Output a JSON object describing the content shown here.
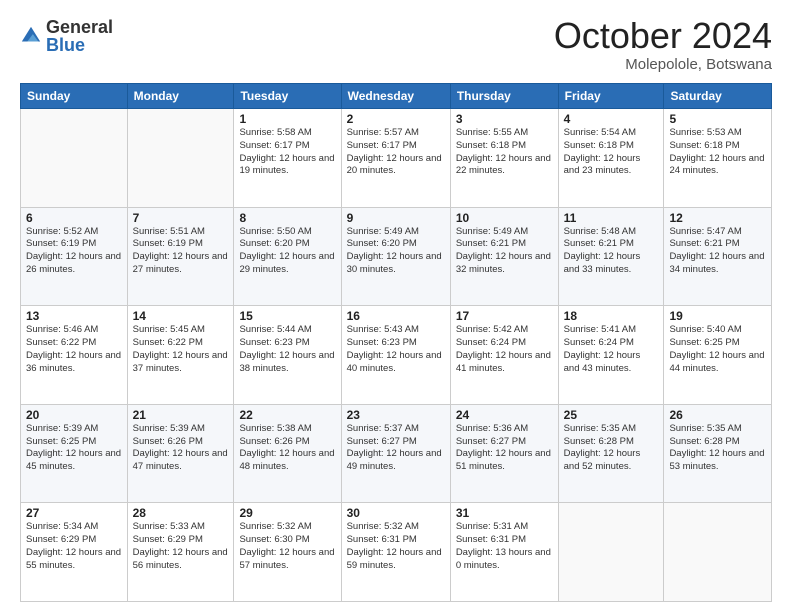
{
  "logo": {
    "general": "General",
    "blue": "Blue"
  },
  "title": "October 2024",
  "location": "Molepolole, Botswana",
  "days_of_week": [
    "Sunday",
    "Monday",
    "Tuesday",
    "Wednesday",
    "Thursday",
    "Friday",
    "Saturday"
  ],
  "weeks": [
    [
      {
        "day": "",
        "info": ""
      },
      {
        "day": "",
        "info": ""
      },
      {
        "day": "1",
        "info": "Sunrise: 5:58 AM\nSunset: 6:17 PM\nDaylight: 12 hours and 19 minutes."
      },
      {
        "day": "2",
        "info": "Sunrise: 5:57 AM\nSunset: 6:17 PM\nDaylight: 12 hours and 20 minutes."
      },
      {
        "day": "3",
        "info": "Sunrise: 5:55 AM\nSunset: 6:18 PM\nDaylight: 12 hours and 22 minutes."
      },
      {
        "day": "4",
        "info": "Sunrise: 5:54 AM\nSunset: 6:18 PM\nDaylight: 12 hours and 23 minutes."
      },
      {
        "day": "5",
        "info": "Sunrise: 5:53 AM\nSunset: 6:18 PM\nDaylight: 12 hours and 24 minutes."
      }
    ],
    [
      {
        "day": "6",
        "info": "Sunrise: 5:52 AM\nSunset: 6:19 PM\nDaylight: 12 hours and 26 minutes."
      },
      {
        "day": "7",
        "info": "Sunrise: 5:51 AM\nSunset: 6:19 PM\nDaylight: 12 hours and 27 minutes."
      },
      {
        "day": "8",
        "info": "Sunrise: 5:50 AM\nSunset: 6:20 PM\nDaylight: 12 hours and 29 minutes."
      },
      {
        "day": "9",
        "info": "Sunrise: 5:49 AM\nSunset: 6:20 PM\nDaylight: 12 hours and 30 minutes."
      },
      {
        "day": "10",
        "info": "Sunrise: 5:49 AM\nSunset: 6:21 PM\nDaylight: 12 hours and 32 minutes."
      },
      {
        "day": "11",
        "info": "Sunrise: 5:48 AM\nSunset: 6:21 PM\nDaylight: 12 hours and 33 minutes."
      },
      {
        "day": "12",
        "info": "Sunrise: 5:47 AM\nSunset: 6:21 PM\nDaylight: 12 hours and 34 minutes."
      }
    ],
    [
      {
        "day": "13",
        "info": "Sunrise: 5:46 AM\nSunset: 6:22 PM\nDaylight: 12 hours and 36 minutes."
      },
      {
        "day": "14",
        "info": "Sunrise: 5:45 AM\nSunset: 6:22 PM\nDaylight: 12 hours and 37 minutes."
      },
      {
        "day": "15",
        "info": "Sunrise: 5:44 AM\nSunset: 6:23 PM\nDaylight: 12 hours and 38 minutes."
      },
      {
        "day": "16",
        "info": "Sunrise: 5:43 AM\nSunset: 6:23 PM\nDaylight: 12 hours and 40 minutes."
      },
      {
        "day": "17",
        "info": "Sunrise: 5:42 AM\nSunset: 6:24 PM\nDaylight: 12 hours and 41 minutes."
      },
      {
        "day": "18",
        "info": "Sunrise: 5:41 AM\nSunset: 6:24 PM\nDaylight: 12 hours and 43 minutes."
      },
      {
        "day": "19",
        "info": "Sunrise: 5:40 AM\nSunset: 6:25 PM\nDaylight: 12 hours and 44 minutes."
      }
    ],
    [
      {
        "day": "20",
        "info": "Sunrise: 5:39 AM\nSunset: 6:25 PM\nDaylight: 12 hours and 45 minutes."
      },
      {
        "day": "21",
        "info": "Sunrise: 5:39 AM\nSunset: 6:26 PM\nDaylight: 12 hours and 47 minutes."
      },
      {
        "day": "22",
        "info": "Sunrise: 5:38 AM\nSunset: 6:26 PM\nDaylight: 12 hours and 48 minutes."
      },
      {
        "day": "23",
        "info": "Sunrise: 5:37 AM\nSunset: 6:27 PM\nDaylight: 12 hours and 49 minutes."
      },
      {
        "day": "24",
        "info": "Sunrise: 5:36 AM\nSunset: 6:27 PM\nDaylight: 12 hours and 51 minutes."
      },
      {
        "day": "25",
        "info": "Sunrise: 5:35 AM\nSunset: 6:28 PM\nDaylight: 12 hours and 52 minutes."
      },
      {
        "day": "26",
        "info": "Sunrise: 5:35 AM\nSunset: 6:28 PM\nDaylight: 12 hours and 53 minutes."
      }
    ],
    [
      {
        "day": "27",
        "info": "Sunrise: 5:34 AM\nSunset: 6:29 PM\nDaylight: 12 hours and 55 minutes."
      },
      {
        "day": "28",
        "info": "Sunrise: 5:33 AM\nSunset: 6:29 PM\nDaylight: 12 hours and 56 minutes."
      },
      {
        "day": "29",
        "info": "Sunrise: 5:32 AM\nSunset: 6:30 PM\nDaylight: 12 hours and 57 minutes."
      },
      {
        "day": "30",
        "info": "Sunrise: 5:32 AM\nSunset: 6:31 PM\nDaylight: 12 hours and 59 minutes."
      },
      {
        "day": "31",
        "info": "Sunrise: 5:31 AM\nSunset: 6:31 PM\nDaylight: 13 hours and 0 minutes."
      },
      {
        "day": "",
        "info": ""
      },
      {
        "day": "",
        "info": ""
      }
    ]
  ]
}
